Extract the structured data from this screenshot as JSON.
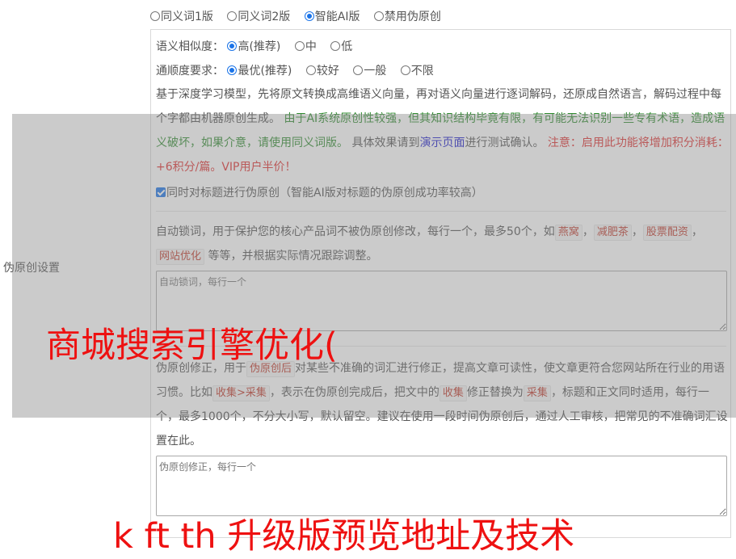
{
  "version_options": [
    {
      "label": "同义词1版",
      "selected": false
    },
    {
      "label": "同义词2版",
      "selected": false
    },
    {
      "label": "智能AI版",
      "selected": true
    },
    {
      "label": "禁用伪原创",
      "selected": false
    }
  ],
  "left_label": "伪原创设置",
  "similarity": {
    "label": "语义相似度：",
    "options": [
      {
        "label": "高(推荐)",
        "selected": true
      },
      {
        "label": "中",
        "selected": false
      },
      {
        "label": "低",
        "selected": false
      }
    ]
  },
  "fluency": {
    "label": "通顺度要求：",
    "options": [
      {
        "label": "最优(推荐)",
        "selected": true
      },
      {
        "label": "较好",
        "selected": false
      },
      {
        "label": "一般",
        "selected": false
      },
      {
        "label": "不限",
        "selected": false
      }
    ]
  },
  "description": {
    "part1": "基于深度学习模型，先将原文转换成高维语义向量，再对语义向量进行逐词解码，还原成自然语言，解码过程中每个字都由机器原创生成。",
    "warning_green": "由于AI系统原创性较强，但其知识结构毕竟有限，有可能无法识别一些专有术语，造成语义破坏，如果介意，请使用同义词版。",
    "part2": "具体效果请到",
    "demo_link": "演示页面",
    "part3": "进行测试确认。",
    "notice_red": "注意：启用此功能将增加积分消耗：+6积分/篇。VIP用户半价！"
  },
  "title_checkbox": {
    "checked": true,
    "label": "同时对标题进行伪原创（智能AI版对标题的伪原创成功率较高）"
  },
  "lock_words": {
    "text_before": "自动锁词，用于保护您的核心产品词不被伪原创修改，每行一个，最多50个，如",
    "examples": [
      "燕窝",
      "减肥茶",
      "股票配资",
      "网站优化"
    ],
    "sep": "，",
    "text_after": "等等，并根据实际情况跟踪调整。",
    "placeholder": "自动锁词，每行一个"
  },
  "correction": {
    "t1": "伪原创修正，用于",
    "chip1": "伪原创后",
    "t2": "对某些不准确的词汇进行修正，提高文章可读性，使文章更符合您网站所在行业的用语习惯。比如",
    "chip2": "收集>采集",
    "t3": "，表示在伪原创完成后，把文中的",
    "chip3": "收集",
    "t4": "修正替换为",
    "chip4": "采集",
    "t5": "，标题和正文同时适用，每行一个，最多1000个，不分大小写，默认留空。建议在使用一段时间伪原创后，通过人工审核，把常见的不准确词汇设置在此。",
    "placeholder": "伪原创修正，每行一个"
  },
  "overlay": {
    "headline1": "商城搜索引擎优化(",
    "headline2": "k        ft   th  升级版预览地址及技术"
  },
  "colors": {
    "accent": "#1a73e8",
    "green": "#2e8b2e",
    "red": "#e03030",
    "link": "#1a1acc",
    "overlay_text": "#ee1111"
  }
}
